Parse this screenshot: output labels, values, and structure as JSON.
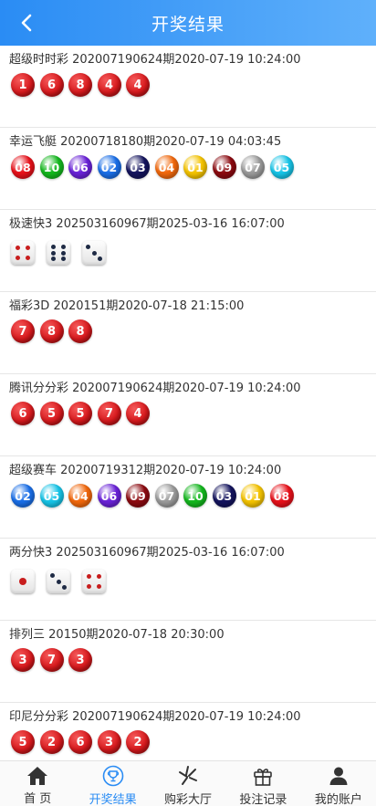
{
  "header": {
    "title": "开奖结果"
  },
  "colors": {
    "red": "#d8191d",
    "ball_colors": {
      "01": "#f5c400",
      "02": "#1a6fe8",
      "03": "#14145e",
      "04": "#f2680c",
      "05": "#17c5e8",
      "06": "#6a22d8",
      "07": "#9b9b9b",
      "08": "#e8111a",
      "09": "#8c0a10",
      "10": "#14b81e"
    },
    "pip_red": "#c81e1e",
    "pip_dark": "#1e2a44",
    "accent": "#2a8cf4"
  },
  "results": [
    {
      "name": "超级时时彩",
      "issue": "202007190624期",
      "time": "2020-07-19 10:24:00",
      "type": "red",
      "numbers": [
        "1",
        "6",
        "8",
        "4",
        "4"
      ]
    },
    {
      "name": "幸运飞艇",
      "issue": "20200718180期",
      "time": "2020-07-19 04:03:45",
      "type": "color",
      "numbers": [
        "08",
        "10",
        "06",
        "02",
        "03",
        "04",
        "01",
        "09",
        "07",
        "05"
      ]
    },
    {
      "name": "极速快3",
      "issue": "202503160967期",
      "time": "2025-03-16 16:07:00",
      "type": "dice",
      "numbers": [
        4,
        6,
        3
      ]
    },
    {
      "name": "福彩3D",
      "issue": "2020151期",
      "time": "2020-07-18 21:15:00",
      "type": "red",
      "numbers": [
        "7",
        "8",
        "8"
      ]
    },
    {
      "name": "腾讯分分彩",
      "issue": "202007190624期",
      "time": "2020-07-19 10:24:00",
      "type": "red",
      "numbers": [
        "6",
        "5",
        "5",
        "7",
        "4"
      ]
    },
    {
      "name": "超级赛车",
      "issue": "20200719312期",
      "time": "2020-07-19 10:24:00",
      "type": "color",
      "numbers": [
        "02",
        "05",
        "04",
        "06",
        "09",
        "07",
        "10",
        "03",
        "01",
        "08"
      ]
    },
    {
      "name": "两分快3",
      "issue": "202503160967期",
      "time": "2025-03-16 16:07:00",
      "type": "dice",
      "numbers": [
        1,
        3,
        4
      ]
    },
    {
      "name": "排列三",
      "issue": "20150期",
      "time": "2020-07-18 20:30:00",
      "type": "red",
      "numbers": [
        "3",
        "7",
        "3"
      ]
    },
    {
      "name": "印尼分分彩",
      "issue": "202007190624期",
      "time": "2020-07-19 10:24:00",
      "type": "red",
      "numbers": [
        "5",
        "2",
        "6",
        "3",
        "2"
      ]
    }
  ],
  "tabbar": [
    {
      "label": "首 页",
      "icon": "home-icon",
      "active": false
    },
    {
      "label": "开奖结果",
      "icon": "trophy-icon",
      "active": true
    },
    {
      "label": "购彩大厅",
      "icon": "lottery-hall-icon",
      "active": false
    },
    {
      "label": "投注记录",
      "icon": "gift-icon",
      "active": false
    },
    {
      "label": "我的账户",
      "icon": "user-icon",
      "active": false
    }
  ]
}
